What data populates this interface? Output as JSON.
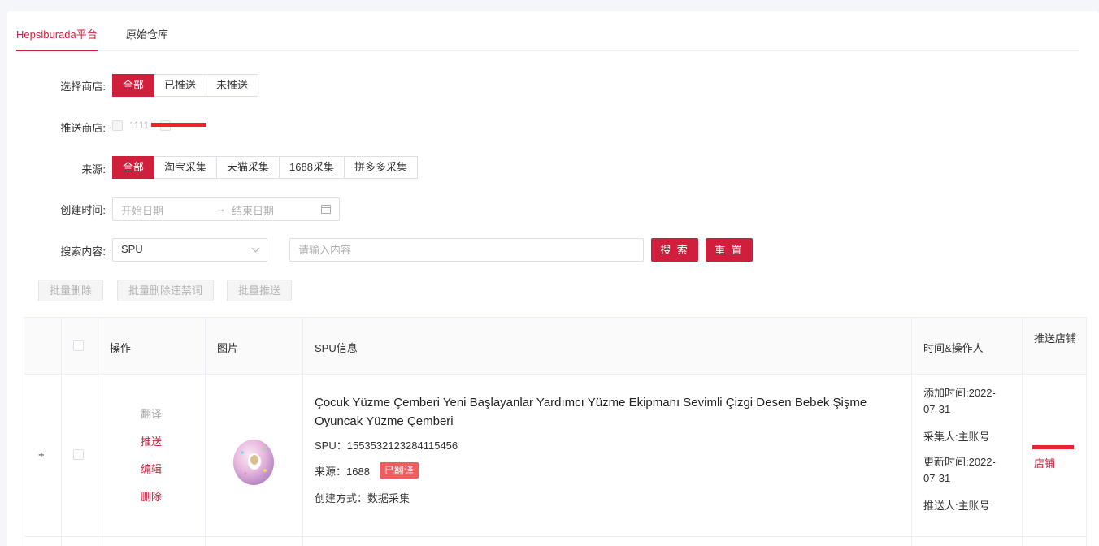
{
  "tabs": [
    {
      "label": "Hepsiburada平台",
      "active": true
    },
    {
      "label": "原始仓库",
      "active": false
    }
  ],
  "filters": {
    "store": {
      "label": "选择商店:",
      "options": [
        "全部",
        "已推送",
        "未推送"
      ],
      "selected": "全部"
    },
    "push_store": {
      "label": "推送商店:",
      "options": [
        "1111"
      ]
    },
    "source": {
      "label": "来源:",
      "options": [
        "全部",
        "淘宝采集",
        "天猫采集",
        "1688采集",
        "拼多多采集"
      ],
      "selected": "全部"
    },
    "created": {
      "label": "创建时间:",
      "start_placeholder": "开始日期",
      "separator": "→",
      "end_placeholder": "结束日期"
    },
    "search": {
      "label": "搜索内容:",
      "field_value": "SPU",
      "placeholder": "请输入内容",
      "search_label": "搜 索",
      "reset_label": "重 置"
    }
  },
  "bulk_actions": [
    "批量删除",
    "批量删除违禁词",
    "批量推送"
  ],
  "table": {
    "headers": {
      "action": "操作",
      "image": "图片",
      "spu_info": "SPU信息",
      "time_operator": "时间&操作人",
      "push_store": "推送店铺"
    },
    "rows": [
      {
        "expand": "+",
        "actions": {
          "translate": "翻译",
          "push": "推送",
          "edit": "编辑",
          "delete": "删除"
        },
        "image": "donut-float-image",
        "title": "Çocuk Yüzme Çemberi Yeni Başlayanlar Yardımcı Yüzme Ekipmanı Sevimli Çizgi Desen Bebek Şişme Oyuncak Yüzme Çemberi",
        "spu": "SPU：1553532123284115456",
        "source": "来源：1688",
        "badge": "已翻译",
        "create_method": "创建方式：数据采集",
        "added_time": "添加时间:2022-07-31",
        "collector": "采集人:主账号",
        "updated_time": "更新时间:2022-07-31",
        "pusher": "推送人:主账号",
        "store_suffix": "店铺"
      }
    ]
  },
  "colors": {
    "accent": "#cf1f3c",
    "badge": "#f05d5d",
    "redact": "#e8262c"
  }
}
